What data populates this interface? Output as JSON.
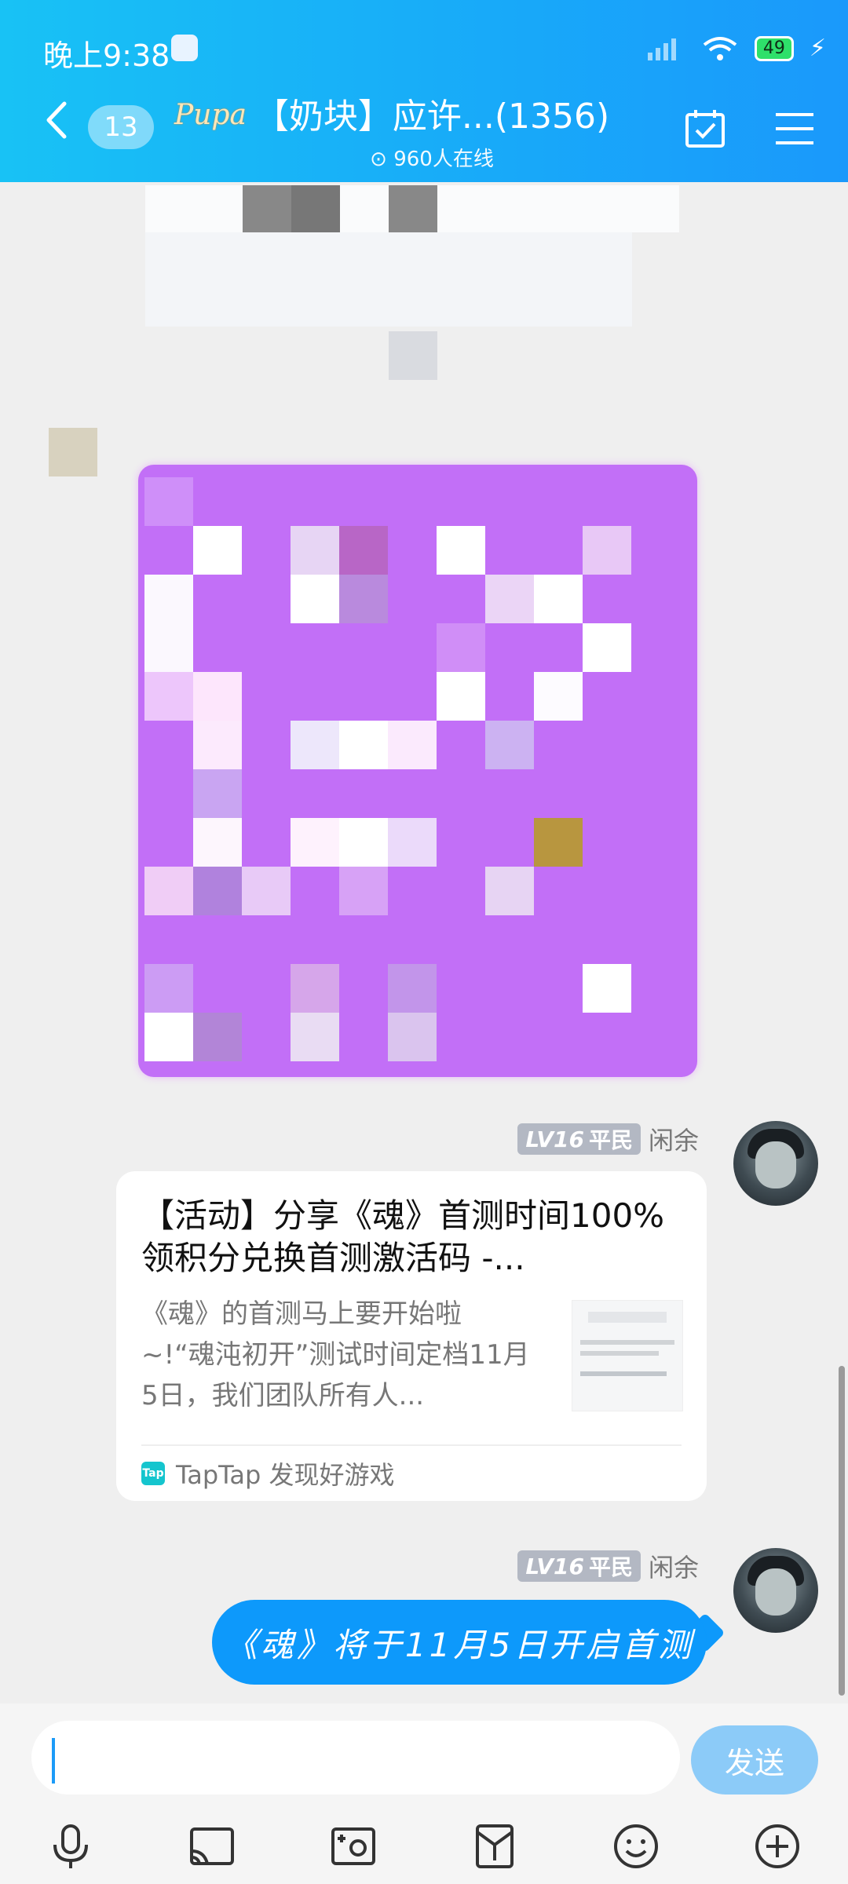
{
  "status_bar": {
    "time": "晚上9:38",
    "battery": "49"
  },
  "header": {
    "unread_count": "13",
    "group_avatar_text": "Pupa",
    "title": "【奶块】应许...(1356)",
    "online": "960人在线"
  },
  "messages": [
    {
      "level_prefix": "LV16",
      "level_title": "平民",
      "nickname": "闲余",
      "card": {
        "title": "【活动】分享《魂》首测时间100%领积分兑换首测激活码 -...",
        "description": "《魂》的首测马上要开始啦~!“魂沌初开”测试时间定档11月5日，我们团队所有人...",
        "source": "TapTap 发现好游戏",
        "logo_text": "Tap"
      }
    },
    {
      "level_prefix": "LV16",
      "level_title": "平民",
      "nickname": "闲余",
      "text": "《魂》将于11月5日开启首测"
    }
  ],
  "input": {
    "send_label": "发送"
  },
  "toolbar": [
    "microphone-icon",
    "screen-share-icon",
    "photo-icon",
    "red-packet-icon",
    "emoji-icon",
    "plus-icon"
  ]
}
